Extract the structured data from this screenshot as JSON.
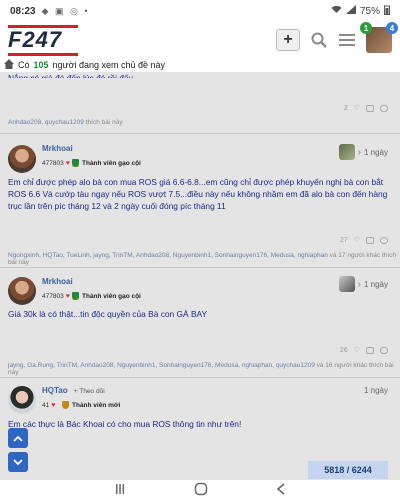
{
  "status_bar": {
    "time": "08:23",
    "battery": "75%"
  },
  "header": {
    "logo": "F247",
    "notification_count": "1",
    "message_count": "4"
  },
  "online_bar": {
    "prefix": "Có",
    "count": "105",
    "suffix": "người đang xem chủ đề này"
  },
  "previous_post": {
    "truncated_text": "Nắng có giá đó đến lúc đó rồi đấy",
    "like_count": "2",
    "likes_line": "Anhdao208, quychau1209",
    "likes_tail": "thích bài này"
  },
  "posts": [
    {
      "author": "Mrkhoai",
      "reputation": "477803",
      "rank": "Thành viên gạo cội",
      "date": "1 ngày",
      "text": "Em chỉ được phép alo bà con mua ROS giá 6.6-6.8...em cũng chỉ được phép khuyến nghị bà con bắt ROS 6.6 Và cướp tàu ngay nếu ROS vượt 7.5...điều này nếu không nhầm em đã alo bà con đến hàng trục lần trên píc tháng 12 và 2 ngày cuối đóng píc tháng 11",
      "like_count": "27",
      "likes_line": "Ngongxinh, HQTao, TueLinh, jayng, TrinTM, Anhdao208, Nguyenbinh1, Sonhainguyen176, Medusa, nghiaphan",
      "likes_tail": "và 17 người khác thích bài này"
    },
    {
      "author": "Mrkhoai",
      "reputation": "477803",
      "rank": "Thành viên gạo cội",
      "date": "1 ngày",
      "text": "Giá 30k là có thật...tin độc quyền của Bà con GÀ BAY",
      "like_count": "26",
      "likes_line": "jayng, Ga.Rung, TrinTM, Anhdao208, Nguyenbinh1, Sonhainguyen176, Medusa, nghiaphan, quychau1209",
      "likes_tail": "và 16 người khác thích bài này"
    },
    {
      "author": "HQTao",
      "follow": "Theo dõi",
      "reputation": "41",
      "rank": "Thành viên mới",
      "date": "1 ngày",
      "text": "Em các thực là Bác Khoai có cho mua ROS thông tin như trên!"
    }
  ],
  "page_counter": "5818 / 6244"
}
